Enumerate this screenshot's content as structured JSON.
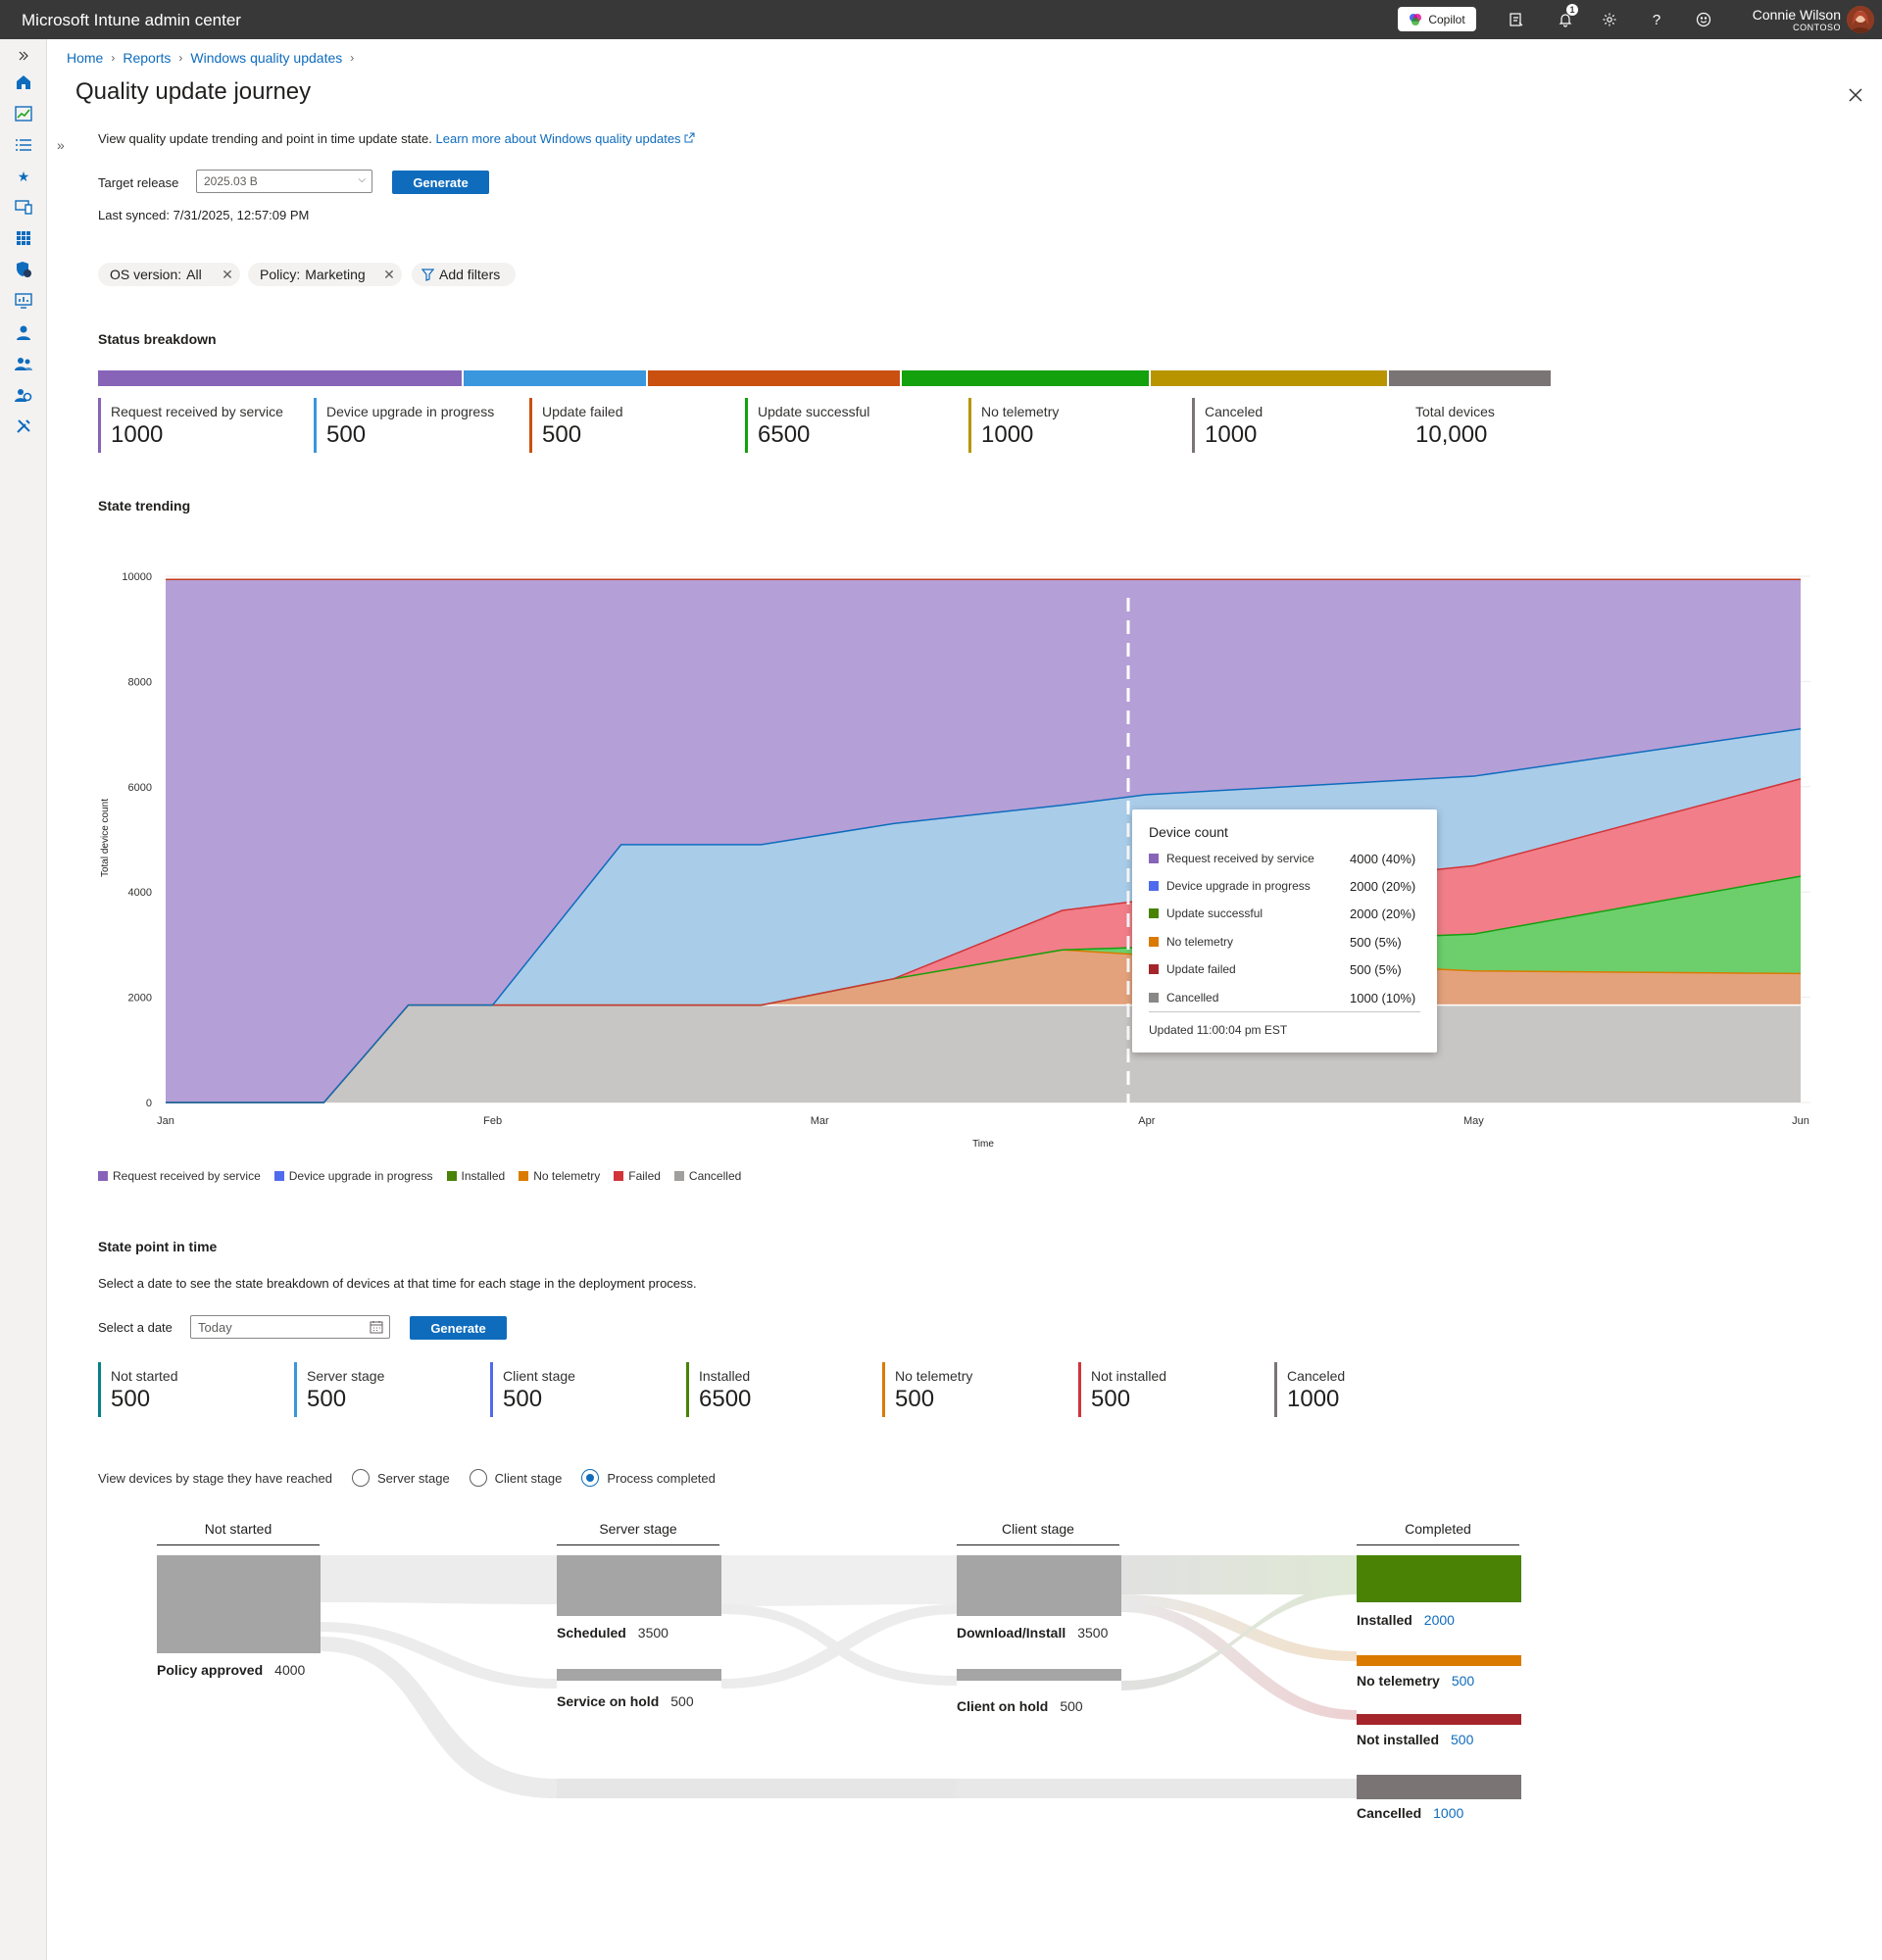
{
  "header": {
    "app_title": "Microsoft Intune admin center",
    "copilot_label": "Copilot",
    "notification_count": "1",
    "user_name": "Connie Wilson",
    "user_org": "CONTOSO"
  },
  "breadcrumb": [
    "Home",
    "Reports",
    "Windows quality updates"
  ],
  "page": {
    "title": "Quality update journey",
    "intro": "View quality update trending and point in time update state.",
    "learn_more": "Learn more about Windows quality updates",
    "target_label": "Target release",
    "target_value": "2025.03 B",
    "generate_label": "Generate",
    "last_synced": "Last synced: 7/31/2025, 12:57:09 PM"
  },
  "filters": {
    "os_label": "OS version:",
    "os_value": "All",
    "policy_label": "Policy:",
    "policy_value": "Marketing",
    "add_filters": "Add filters"
  },
  "status_breakdown": {
    "title": "Status breakdown",
    "items": [
      {
        "label": "Request received by service",
        "value": "1000",
        "color": "#8764b8"
      },
      {
        "label": "Device upgrade in progress",
        "value": "500",
        "color": "#3a96dd"
      },
      {
        "label": "Update failed",
        "value": "500",
        "color": "#ca5010"
      },
      {
        "label": "Update successful",
        "value": "6500",
        "color": "#13a10e"
      },
      {
        "label": "No telemetry",
        "value": "1000",
        "color": "#b89500"
      },
      {
        "label": "Canceled",
        "value": "1000",
        "color": "#7a7574"
      },
      {
        "label": "Total devices",
        "value": "10,000"
      }
    ]
  },
  "state_trending": {
    "title": "State trending",
    "ylabel": "Total device count",
    "xlabel": "Time"
  },
  "chart_data": {
    "type": "area",
    "stacked": true,
    "x": [
      "Jan 1",
      "Jan 16",
      "Jan 24",
      "Feb 1",
      "Feb 12",
      "Feb 24",
      "Mar 8",
      "Mar 24",
      "Apr 1",
      "May 1",
      "Jun 1"
    ],
    "x_ticks": [
      "Jan",
      "Feb",
      "Mar",
      "Apr",
      "May",
      "Jun"
    ],
    "y_ticks": [
      "0",
      "2000",
      "4000",
      "6000",
      "8000",
      "10000"
    ],
    "ylim": [
      0,
      10000
    ],
    "series": [
      {
        "name": "Cancelled",
        "color": "#c8c6c4",
        "values": [
          0,
          0,
          1850,
          1850,
          1850,
          1850,
          1850,
          1850,
          1850,
          1850,
          1850
        ]
      },
      {
        "name": "No telemetry",
        "color": "#e3a27c",
        "values": [
          0,
          0,
          0,
          0,
          0,
          0,
          500,
          1050,
          950,
          650,
          600
        ]
      },
      {
        "name": "Installed",
        "color": "#6ccf6c",
        "values": [
          0,
          0,
          0,
          0,
          0,
          0,
          0,
          0,
          150,
          700,
          1850
        ]
      },
      {
        "name": "Failed",
        "color": "#f17e88",
        "values": [
          0,
          0,
          0,
          0,
          0,
          0,
          0,
          750,
          900,
          1300,
          1850
        ]
      },
      {
        "name": "Device upgrade in progress",
        "color": "#a9cce9",
        "values": [
          0,
          0,
          0,
          0,
          3050,
          3050,
          2950,
          2000,
          2000,
          1700,
          950
        ]
      },
      {
        "name": "Request received by service",
        "color": "#b59fd7",
        "values": [
          9940,
          9940,
          8090,
          8090,
          5040,
          5040,
          4640,
          4290,
          4090,
          3740,
          2840
        ]
      }
    ]
  },
  "legend": [
    {
      "name": "Request received by service",
      "color": "#8764b8"
    },
    {
      "name": "Device upgrade in progress",
      "color": "#4f6bed"
    },
    {
      "name": "Installed",
      "color": "#498205"
    },
    {
      "name": "No telemetry",
      "color": "#da7b00"
    },
    {
      "name": "Failed",
      "color": "#d13438"
    },
    {
      "name": "Cancelled",
      "color": "#a19f9d"
    }
  ],
  "tooltip": {
    "title": "Device count",
    "rows": [
      {
        "label": "Request received by service",
        "value": "4000 (40%)",
        "color": "#8764b8"
      },
      {
        "label": "Device upgrade in progress",
        "value": "2000 (20%)",
        "color": "#4f6bed"
      },
      {
        "label": "Update successful",
        "value": "2000 (20%)",
        "color": "#498205"
      },
      {
        "label": "No telemetry",
        "value": "500 (5%)",
        "color": "#da7b00"
      },
      {
        "label": "Update failed",
        "value": "500 (5%)",
        "color": "#a4262c"
      },
      {
        "label": "Cancelled",
        "value": "1000 (10%)",
        "color": "#8a8886"
      }
    ],
    "footer": "Updated 11:00:04 pm EST"
  },
  "point_in_time": {
    "title": "State point in time",
    "description": "Select a date to see the state breakdown of devices at that time for each stage in the deployment process.",
    "date_label": "Select a date",
    "date_placeholder": "Today",
    "generate_label": "Generate",
    "stats": [
      {
        "label": "Not started",
        "value": "500",
        "color": "#038387"
      },
      {
        "label": "Server stage",
        "value": "500",
        "color": "#3a96dd"
      },
      {
        "label": "Client stage",
        "value": "500",
        "color": "#4f6bed"
      },
      {
        "label": "Installed",
        "value": "6500",
        "color": "#498205"
      },
      {
        "label": "No telemetry",
        "value": "500",
        "color": "#da7b00"
      },
      {
        "label": "Not installed",
        "value": "500",
        "color": "#d13438"
      },
      {
        "label": "Canceled",
        "value": "1000",
        "color": "#7a7574"
      }
    ],
    "radio_prompt": "View devices by stage they have reached",
    "radio_options": [
      "Server stage",
      "Client stage",
      "Process completed"
    ],
    "radio_selected": "Process completed"
  },
  "sankey": {
    "columns": [
      "Not started",
      "Server stage",
      "Client stage",
      "Completed"
    ],
    "nodes": {
      "policy_approved": {
        "label": "Policy approved",
        "value": "4000"
      },
      "scheduled": {
        "label": "Scheduled",
        "value": "3500"
      },
      "service_on_hold": {
        "label": "Service on hold",
        "value": "500"
      },
      "download_install": {
        "label": "Download/Install",
        "value": "3500"
      },
      "client_on_hold": {
        "label": "Client on hold",
        "value": "500"
      },
      "installed": {
        "label": "Installed",
        "value": "2000",
        "color": "#498205"
      },
      "no_telemetry": {
        "label": "No telemetry",
        "value": "500",
        "color": "#da7b00"
      },
      "not_installed": {
        "label": "Not installed",
        "value": "500",
        "color": "#a4262c"
      },
      "cancelled": {
        "label": "Cancelled",
        "value": "1000",
        "color": "#7a7574"
      }
    }
  }
}
